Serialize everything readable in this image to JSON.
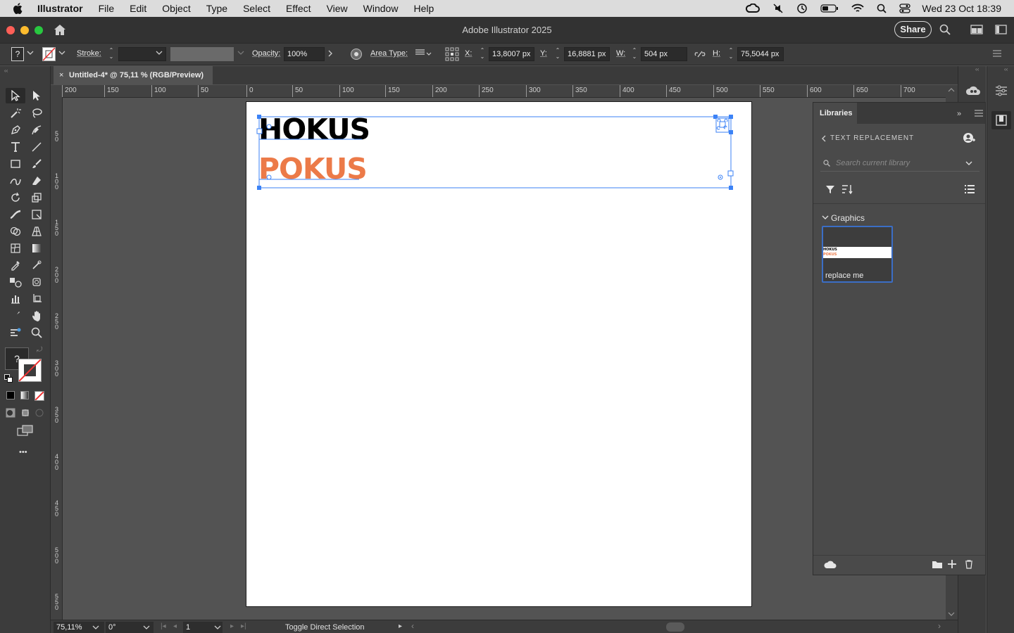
{
  "menubar": {
    "app_name": "Illustrator",
    "items": [
      "File",
      "Edit",
      "Object",
      "Type",
      "Select",
      "Effect",
      "View",
      "Window",
      "Help"
    ],
    "clock": "Wed 23 Oct  18:39"
  },
  "titlebar": {
    "title": "Adobe Illustrator 2025",
    "share_label": "Share"
  },
  "controlbar": {
    "fill_tooltip": "?",
    "stroke_label": "Stroke:",
    "opacity_label": "Opacity:",
    "opacity_value": "100%",
    "area_type_label": "Area Type:",
    "x_label": "X:",
    "x_value": "13,8007 px",
    "y_label": "Y:",
    "y_value": "16,8881 px",
    "w_label": "W:",
    "w_value": "504 px",
    "h_label": "H:",
    "h_value": "75,5044 px"
  },
  "document": {
    "tab_label": "Untitled-4* @ 75,11 % (RGB/Preview)",
    "close_glyph": "×"
  },
  "ruler": {
    "h_labels": [
      "200",
      "150",
      "100",
      "50",
      "0",
      "50",
      "100",
      "150",
      "200",
      "250",
      "300",
      "350",
      "400",
      "450",
      "500",
      "550",
      "600",
      "650",
      "700"
    ],
    "v_labels": [
      "5\n0",
      "1\n0\n0",
      "1\n5\n0",
      "2\n0\n0",
      "2\n5\n0",
      "3\n0\n0",
      "3\n5\n0",
      "4\n0\n0",
      "4\n5\n0",
      "5\n0\n0",
      "5\n5\n0"
    ]
  },
  "artboard": {
    "line1": "HOKUS",
    "line2": "POKUS",
    "line1_color": "#000000",
    "line2_color": "#ec7a48",
    "selection_color": "#3b82f6"
  },
  "libraries": {
    "tab_label": "Libraries",
    "breadcrumb": "TEXT REPLACEMENT",
    "search_placeholder": "Search current library",
    "section_label": "Graphics",
    "asset_thumb_line1": "HOKUS",
    "asset_thumb_line2": "POKUS",
    "asset_name": "replace me"
  },
  "statusbar": {
    "zoom": "75,11%",
    "rotation": "0°",
    "artboard_num": "1",
    "status_text": "Toggle Direct Selection"
  },
  "toolbar": {
    "more_glyph": "•••",
    "unknown_glyph": "?"
  }
}
